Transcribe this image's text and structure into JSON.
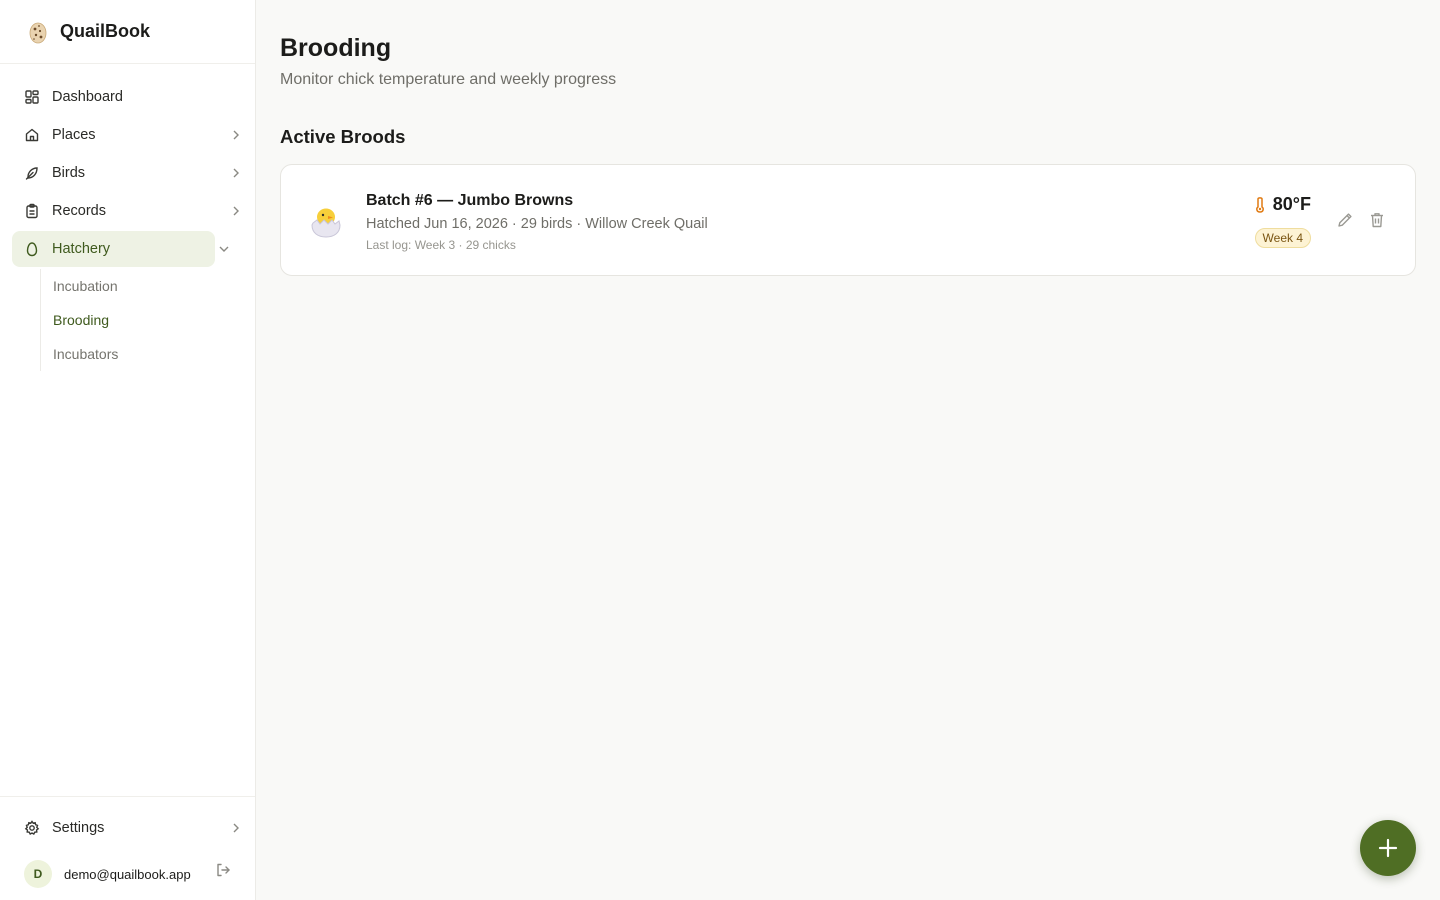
{
  "app": {
    "name": "QuailBook"
  },
  "colors": {
    "accent": "#4f6e24",
    "active_bg": "#eef2e4",
    "badge_bg": "#fdf3d4"
  },
  "sidebar": {
    "items": [
      {
        "label": "Dashboard",
        "icon": "dashboard-grid-icon"
      },
      {
        "label": "Places",
        "icon": "home-icon"
      },
      {
        "label": "Birds",
        "icon": "feather-icon"
      },
      {
        "label": "Records",
        "icon": "clipboard-icon"
      },
      {
        "label": "Hatchery",
        "icon": "egg-icon"
      }
    ],
    "hatchery_sub": [
      "Incubation",
      "Brooding",
      "Incubators"
    ],
    "settings": "Settings",
    "user": {
      "initial": "D",
      "email": "demo@quailbook.app"
    }
  },
  "main": {
    "title": "Brooding",
    "subtitle": "Monitor chick temperature and weekly progress",
    "section": "Active Broods",
    "broods": [
      {
        "title": "Batch #6 — Jumbo Browns",
        "meta": "Hatched Jun 16, 2026 · 29 birds · Willow Creek Quail",
        "last_log": "Last log: Week 3 · 29 chicks",
        "temperature": "80°F",
        "week": "Week 4"
      }
    ]
  }
}
